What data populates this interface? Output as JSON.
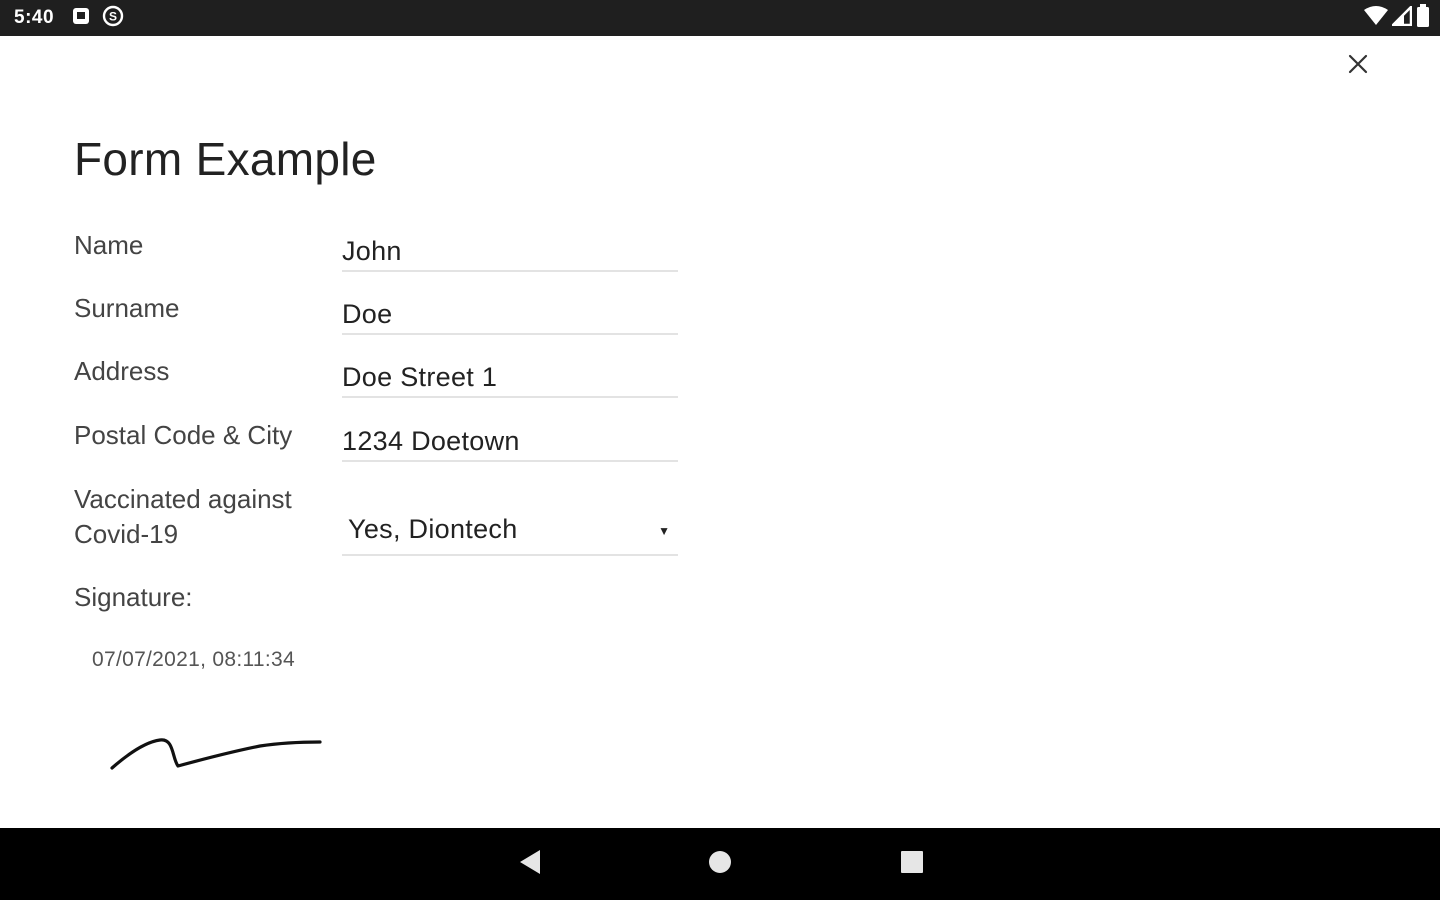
{
  "status_bar": {
    "time": "5:40",
    "left_icons": [
      "notification-square-icon",
      "data-saver-icon"
    ],
    "right_icons": [
      "wifi-icon",
      "cell-signal-icon",
      "battery-icon"
    ]
  },
  "dialog": {
    "close_icon": "close-icon",
    "title": "Form Example"
  },
  "form": {
    "fields": [
      {
        "label": "Name",
        "value": "John"
      },
      {
        "label": "Surname",
        "value": "Doe"
      },
      {
        "label": "Address",
        "value": "Doe Street 1"
      },
      {
        "label": "Postal Code & City",
        "value": "1234 Doetown"
      }
    ],
    "vaccination": {
      "label_line1": "Vaccinated against",
      "label_line2": "Covid-19",
      "selected": "Yes, Diontech"
    },
    "signature": {
      "label": "Signature:",
      "timestamp": "07/07/2021, 08:11:34"
    }
  },
  "nav_bar": {
    "buttons": [
      "back-icon",
      "home-icon",
      "recents-icon"
    ]
  },
  "colors": {
    "status_bar_bg": "#1f1f1f",
    "nav_bar_bg": "#000000",
    "underline": "#e3e3e3",
    "text": "#222222"
  }
}
